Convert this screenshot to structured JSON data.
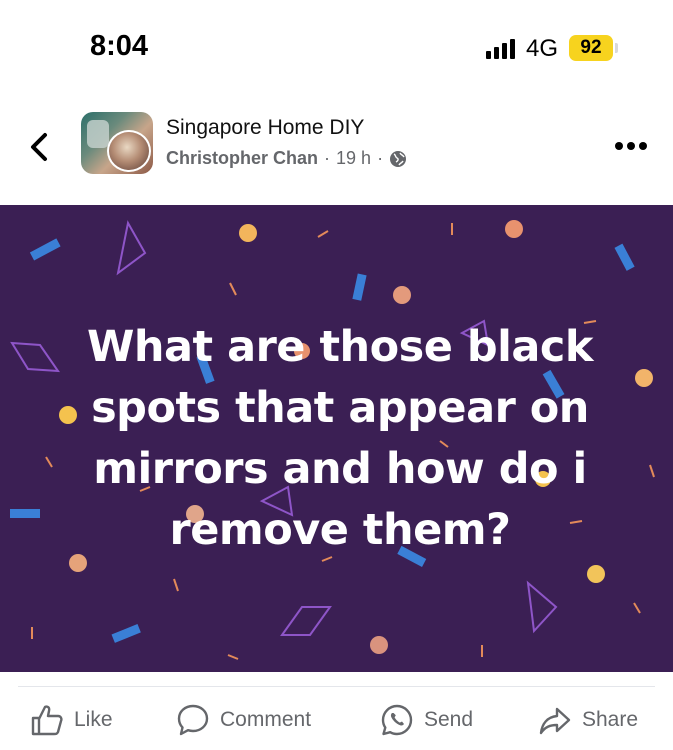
{
  "status_bar": {
    "time": "8:04",
    "network": "4G",
    "battery": "92",
    "battery_color": "#f7d31e"
  },
  "header": {
    "back_icon": "chevron-left-icon",
    "group_name": "Singapore Home DIY",
    "author": "Christopher Chan",
    "separator": "·",
    "time_ago": "19 h",
    "privacy_icon": "globe-icon",
    "more_icon": "more-horizontal-icon"
  },
  "post": {
    "background_color": "#3b1f54",
    "text_lines": [
      "What are those black",
      "spots that appear on",
      "mirrors and how do i",
      "remove them?"
    ]
  },
  "actions": [
    {
      "label": "Like",
      "icon": "thumbs-up-icon"
    },
    {
      "label": "Comment",
      "icon": "comment-bubble-icon"
    },
    {
      "label": "Send",
      "icon": "whatsapp-icon"
    },
    {
      "label": "Share",
      "icon": "share-arrow-icon"
    }
  ]
}
